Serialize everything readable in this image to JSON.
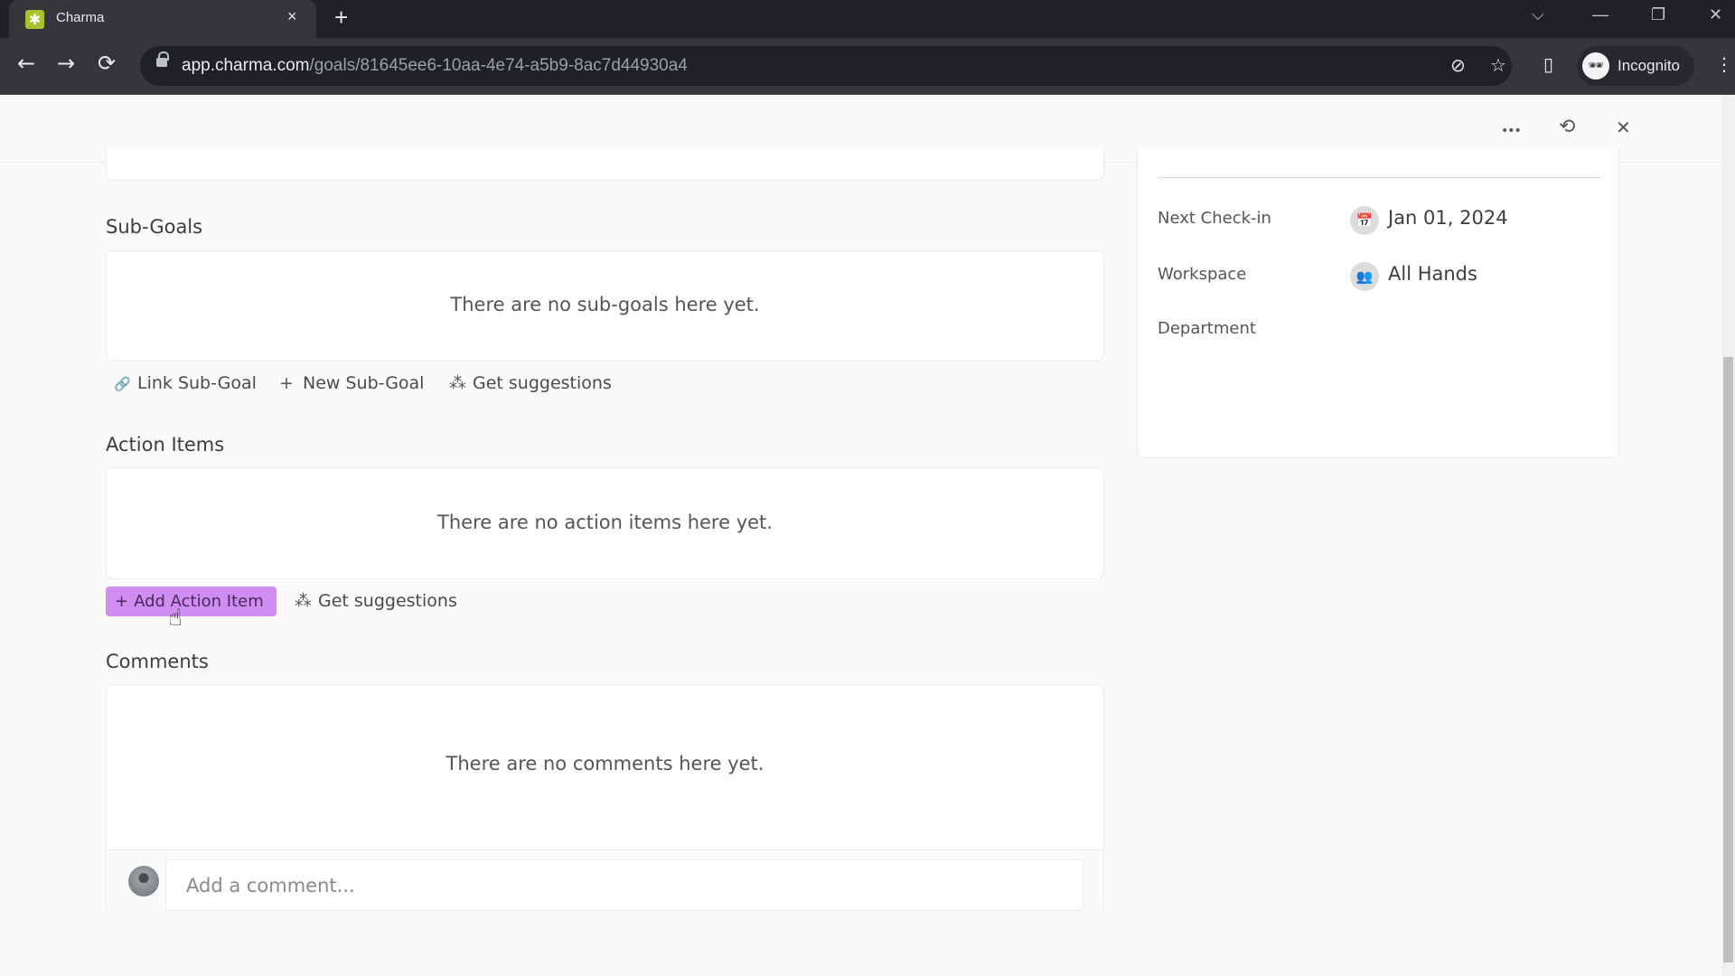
{
  "browser": {
    "tab_title": "Charma",
    "tab_close": "×",
    "new_tab": "+",
    "url_host": "app.charma.com",
    "url_path": "/goals/81645ee6-10aa-4e74-a5b9-8ac7d44930a4",
    "profile_label": "Incognito",
    "window_controls": {
      "tab_search": "⌵",
      "minimize": "—",
      "restore": "❐",
      "close": "✕"
    },
    "nav": {
      "back": "←",
      "forward": "→",
      "reload": "⟳"
    }
  },
  "header": {
    "more_icon": "•••",
    "history_icon": "⟲",
    "close_icon": "✕"
  },
  "sub_goals": {
    "label": "Sub-Goals",
    "empty_text": "There are no sub-goals here yet.",
    "actions": [
      {
        "icon": "link-icon",
        "glyph": "🔗",
        "label": "Link Sub-Goal"
      },
      {
        "icon": "plus-icon",
        "glyph": "+",
        "label": "New Sub-Goal"
      },
      {
        "icon": "magic-wand-icon",
        "glyph": "⁂",
        "label": "Get suggestions"
      }
    ]
  },
  "action_items": {
    "label": "Action Items",
    "empty_text": "There are no action items here yet.",
    "add_button": {
      "glyph": "+",
      "label": "Add Action Item",
      "color": "#cf8df2"
    },
    "suggestions": {
      "glyph": "⁂",
      "label": "Get suggestions"
    }
  },
  "comments": {
    "label": "Comments",
    "empty_text": "There are no comments here yet.",
    "input_placeholder": "Add a comment...",
    "input_value": ""
  },
  "details": {
    "rows": [
      {
        "label": "Next Check-in",
        "icon": "calendar-icon",
        "glyph": "📅",
        "value": "Jan 01, 2024"
      },
      {
        "label": "Workspace",
        "icon": "users-icon",
        "glyph": "👥",
        "value": "All Hands"
      },
      {
        "label": "Department",
        "icon": "",
        "glyph": "",
        "value": ""
      }
    ]
  }
}
